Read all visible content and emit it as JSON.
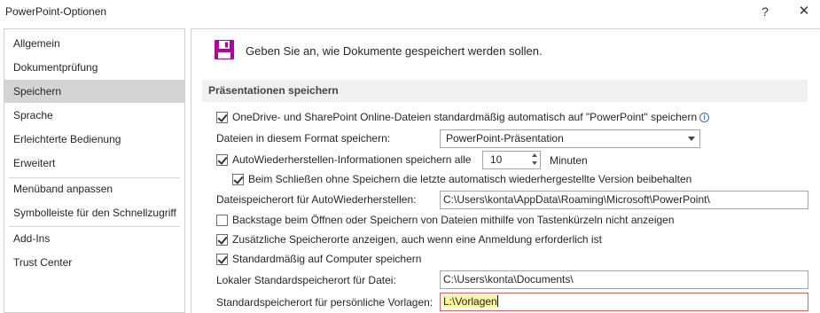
{
  "window": {
    "title": "PowerPoint-Optionen",
    "help_label": "?",
    "close_label": "✕"
  },
  "sidebar": {
    "items": [
      {
        "label": "Allgemein"
      },
      {
        "label": "Dokumentprüfung"
      },
      {
        "label": "Speichern",
        "selected": true
      },
      {
        "label": "Sprache"
      },
      {
        "label": "Erleichterte Bedienung"
      },
      {
        "label": "Erweitert"
      },
      {
        "label": "Menüband anpassen"
      },
      {
        "label": "Symbolleiste für den Schnellzugriff"
      },
      {
        "label": "Add-Ins"
      },
      {
        "label": "Trust Center"
      }
    ]
  },
  "header": {
    "icon": "save-icon",
    "text": "Geben Sie an, wie Dokumente gespeichert werden sollen."
  },
  "section": {
    "title": "Präsentationen speichern",
    "onedrive_autosave": {
      "checked": true,
      "label": "OneDrive- und SharePoint Online-Dateien standardmäßig automatisch auf \"PowerPoint\" speichern",
      "info_icon": "info-icon",
      "info_glyph": "i"
    },
    "format": {
      "label": "Dateien in diesem Format speichern:",
      "value": "PowerPoint-Präsentation"
    },
    "autorecover": {
      "checked": true,
      "label": "AutoWiederherstellen-Informationen speichern alle",
      "value": "10",
      "unit": "Minuten"
    },
    "keep_last": {
      "checked": true,
      "label": "Beim Schließen ohne Speichern die letzte automatisch wiederhergestellte Version beibehalten"
    },
    "autorecover_path": {
      "label": "Dateispeicherort für AutoWiederherstellen:",
      "value": "C:\\Users\\konta\\AppData\\Roaming\\Microsoft\\PowerPoint\\"
    },
    "backstage": {
      "checked": false,
      "label": "Backstage beim Öffnen oder Speichern von Dateien mithilfe von Tastenkürzeln nicht anzeigen"
    },
    "additional_locations": {
      "checked": true,
      "label": "Zusätzliche Speicherorte anzeigen, auch wenn eine Anmeldung erforderlich ist"
    },
    "save_to_computer": {
      "checked": true,
      "label": "Standardmäßig auf Computer speichern"
    },
    "local_path": {
      "label": "Lokaler Standardspeicherort für Datei:",
      "value": "C:\\Users\\konta\\Documents\\"
    },
    "templates_path": {
      "label": "Standardspeicherort für persönliche Vorlagen:",
      "value": "L:\\Vorlagen"
    }
  },
  "colors": {
    "selected_nav": "#d4d4d4",
    "section_header": "#f0f0f0",
    "highlight": "#fbf59d",
    "field_error_border": "#e06060",
    "info_blue": "#2b6fc2"
  }
}
